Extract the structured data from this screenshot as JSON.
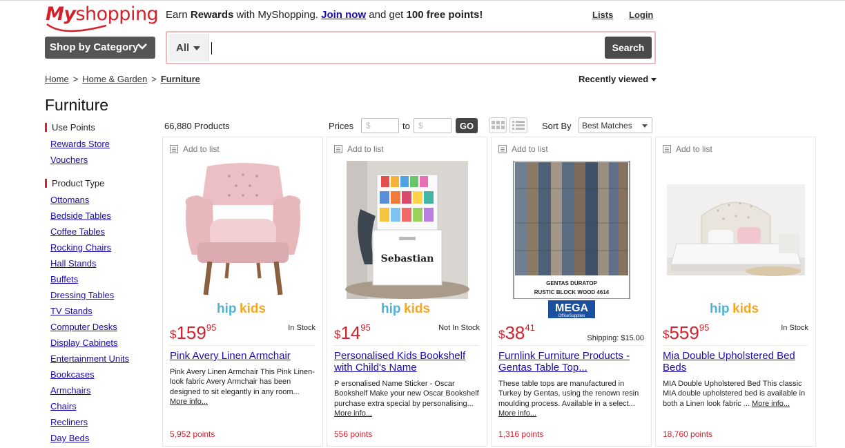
{
  "header": {
    "logo_my": "My",
    "logo_shopping": "shopping",
    "promo": {
      "text1": "Earn ",
      "bold1": "Rewards",
      "text2": " with MyShopping. ",
      "join": "Join now",
      "text3": " and get ",
      "bold2": "100 free points!"
    },
    "lists": "Lists",
    "login": "Login",
    "shop_by_category": "Shop by Category",
    "search_scope": "All",
    "search_value": "",
    "search_button": "Search"
  },
  "breadcrumb": [
    "Home",
    "Home & Garden",
    "Furniture"
  ],
  "recently_viewed": "Recently viewed",
  "page_title": "Furniture",
  "sidebar": {
    "use_points": {
      "heading": "Use Points",
      "items": [
        "Rewards Store",
        "Vouchers"
      ]
    },
    "product_type": {
      "heading": "Product Type",
      "items": [
        "Ottomans",
        "Bedside Tables",
        "Coffee Tables",
        "Rocking Chairs",
        "Hall Stands",
        "Buffets",
        "Dressing Tables",
        "TV Stands",
        "Computer Desks",
        "Display Cabinets",
        "Entertainment Units",
        "Bookcases",
        "Armchairs",
        "Chairs",
        "Recliners",
        "Day Beds"
      ]
    }
  },
  "toolbar": {
    "count": "66,880 Products",
    "prices_label": "Prices",
    "min_placeholder": "$",
    "to": "to",
    "max_placeholder": "$",
    "go": "GO",
    "sort_label": "Sort By",
    "sort_value": "Best Matches"
  },
  "products": [
    {
      "add_to_list": "Add to list",
      "brand": "hipkids",
      "currency": "$",
      "dollars": "159",
      "cents": "95",
      "stock": "In Stock",
      "shipping": "",
      "title": "Pink Avery Linen Armchair",
      "desc": "Pink Avery Linen Armchair This Pink Linen-look fabric Avery Armchair has been designed to sit elegantly in any room...",
      "more": "More info...",
      "points": "5,952 points"
    },
    {
      "add_to_list": "Add to list",
      "brand": "hipkids",
      "currency": "$",
      "dollars": "14",
      "cents": "95",
      "stock": "Not In Stock",
      "shipping": "",
      "title": "Personalised Kids Bookshelf with Child's Name",
      "desc": "P ersonalised Name Sticker - Oscar Bookshelf Make your new Oscar Bookshelf purchase extra special by personalising...",
      "more": "More info...",
      "points": "556 points",
      "image_text": "Sebastian"
    },
    {
      "add_to_list": "Add to list",
      "brand": "MEGA",
      "brand_sub": "OfficeSupplies",
      "currency": "$",
      "dollars": "38",
      "cents": "41",
      "stock": "",
      "shipping": "Shipping: $15.00",
      "title": "Furnlink Furniture Products - Gentas Table Top...",
      "desc": "These table tops are manufactured in Turkey by Gentas, using the renown resin moulding process. Available in a select...",
      "more": "More info...",
      "points": "1,316 points",
      "image_caption1": "GENTAS DURATOP",
      "image_caption2": "RUSTIC BLOCK WOOD 4614"
    },
    {
      "add_to_list": "Add to list",
      "brand": "hipkids",
      "currency": "$",
      "dollars": "559",
      "cents": "95",
      "stock": "In Stock",
      "shipping": "",
      "title": "Mia Double Upholstered Bed Beds",
      "desc": "MIA Double Upholstered Bed This classic MIA double upholstered bed is available in both a Linen look fabric ...",
      "more": "More info...",
      "points": "18,760 points"
    }
  ],
  "colors": {
    "brand_red": "#d4202b",
    "link_blue": "#1a0dab",
    "dark_button": "#4a4a4a"
  }
}
